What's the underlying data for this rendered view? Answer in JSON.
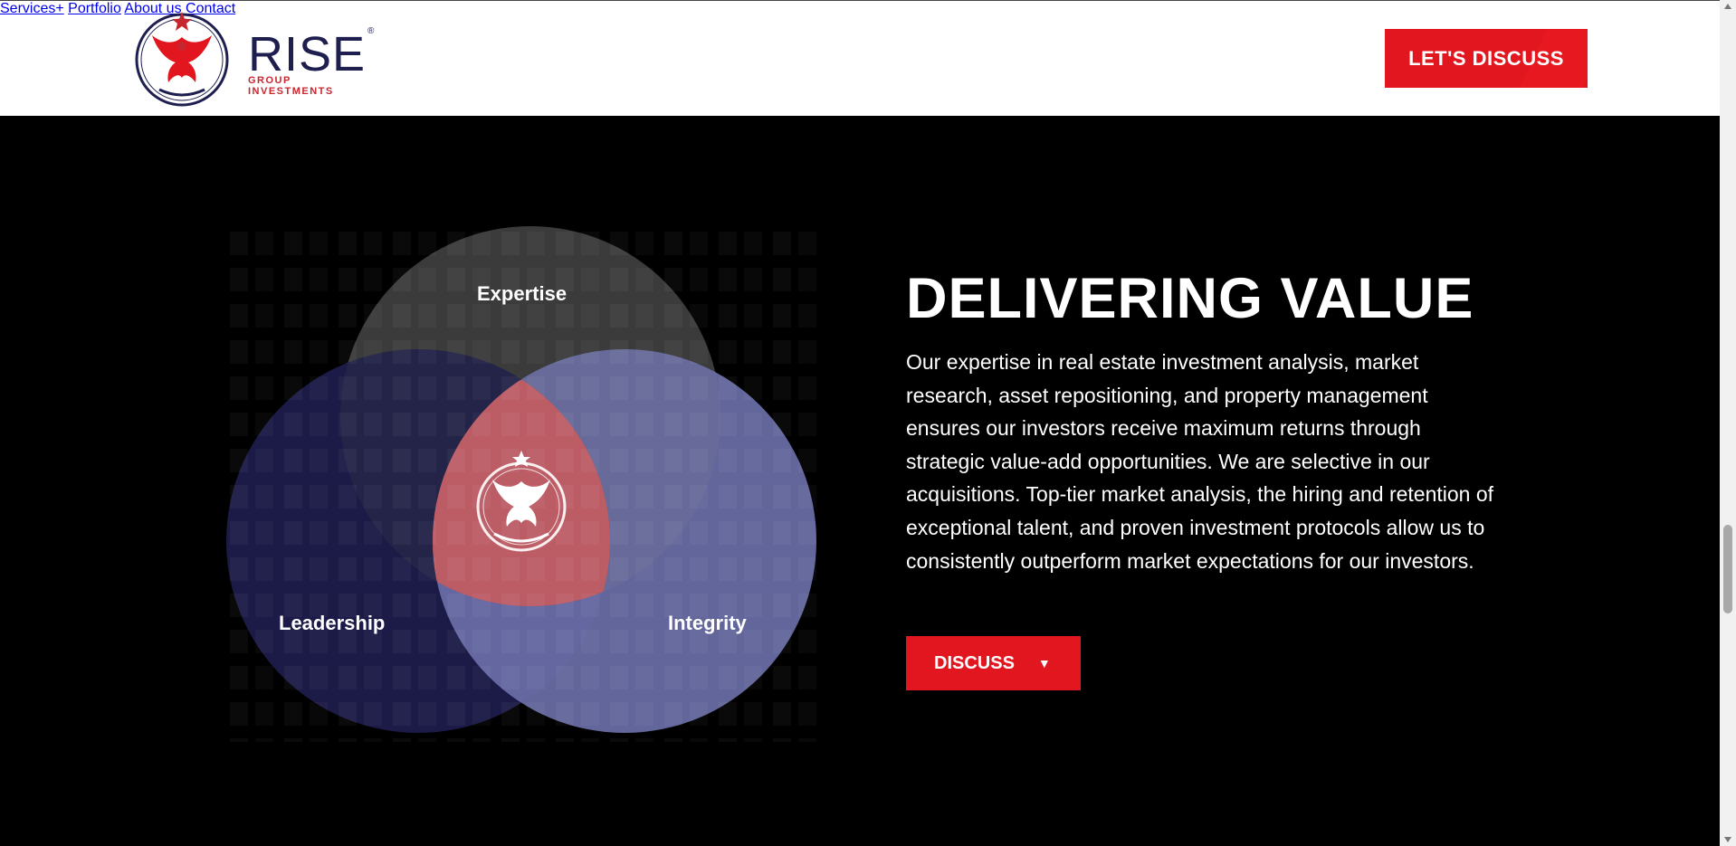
{
  "brand": {
    "name": "RISE",
    "registered": "®",
    "tagline": "GROUP INVESTMENTS",
    "colors": {
      "primary": "#1e1f4f",
      "accent": "#e1161f"
    }
  },
  "nav": {
    "items": [
      "Services+",
      "Portfolio",
      "About us",
      "Contact"
    ],
    "cta": "LET'S DISCUSS"
  },
  "venn": {
    "labels": {
      "top": "Expertise",
      "left": "Leadership",
      "right": "Integrity"
    },
    "center_icon": "phoenix-emblem-icon",
    "colors": {
      "top": "#3a3b3a",
      "left": "#1d1c4a",
      "right": "#6b6fa8",
      "center": "#e9554f"
    }
  },
  "section": {
    "headline": "DELIVERING VALUE",
    "paragraph": "Our expertise in real estate investment analysis, market research, asset repositioning, and property management ensures our investors receive maximum returns through strategic value-add opportunities. We are selective in our acquisitions. Top-tier market analysis, the hiring and retention of exceptional talent, and proven investment protocols allow us to consistently outperform market expectations for our investors.",
    "button": "DISCUSS",
    "button_icon": "caret-down-icon"
  }
}
